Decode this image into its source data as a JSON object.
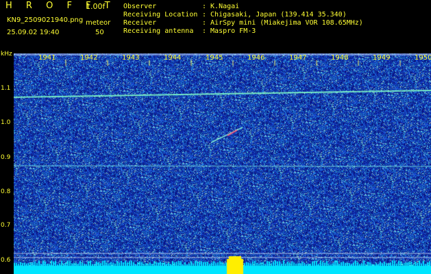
{
  "header": {
    "app_name": "H R O F F T",
    "version": "1.00f",
    "filename": "KN9_2509021940.png",
    "mode_label": "meteor",
    "datetime": "25.09.02 19:40",
    "count_value": "50"
  },
  "info": {
    "rows": [
      {
        "key": "Observer",
        "value": ": K.Nagai"
      },
      {
        "key": "Receiving Location",
        "value": ": Chigasaki, Japan (139.414 35.340)"
      },
      {
        "key": "Receiver",
        "value": ": AirSpy mini (Miakejima VOR 108.65MHz)"
      },
      {
        "key": "Receiving antenna",
        "value": ": Maspro FM-3"
      }
    ]
  },
  "axis": {
    "unit": "kHz",
    "y_ticks": [
      "1.1",
      "1.0",
      "0.9",
      "0.8",
      "0.7",
      "0.6"
    ],
    "time_ticks": [
      "1941",
      "1942",
      "1943",
      "1944",
      "1945",
      "1946",
      "1947",
      "1948",
      "1949",
      "1950"
    ]
  },
  "colors": {
    "text": "#ffff33",
    "background": "#000000",
    "noise_base": "#1a2a9a",
    "signal": "#66ffcc",
    "level_bar": "#00e5ff"
  }
}
